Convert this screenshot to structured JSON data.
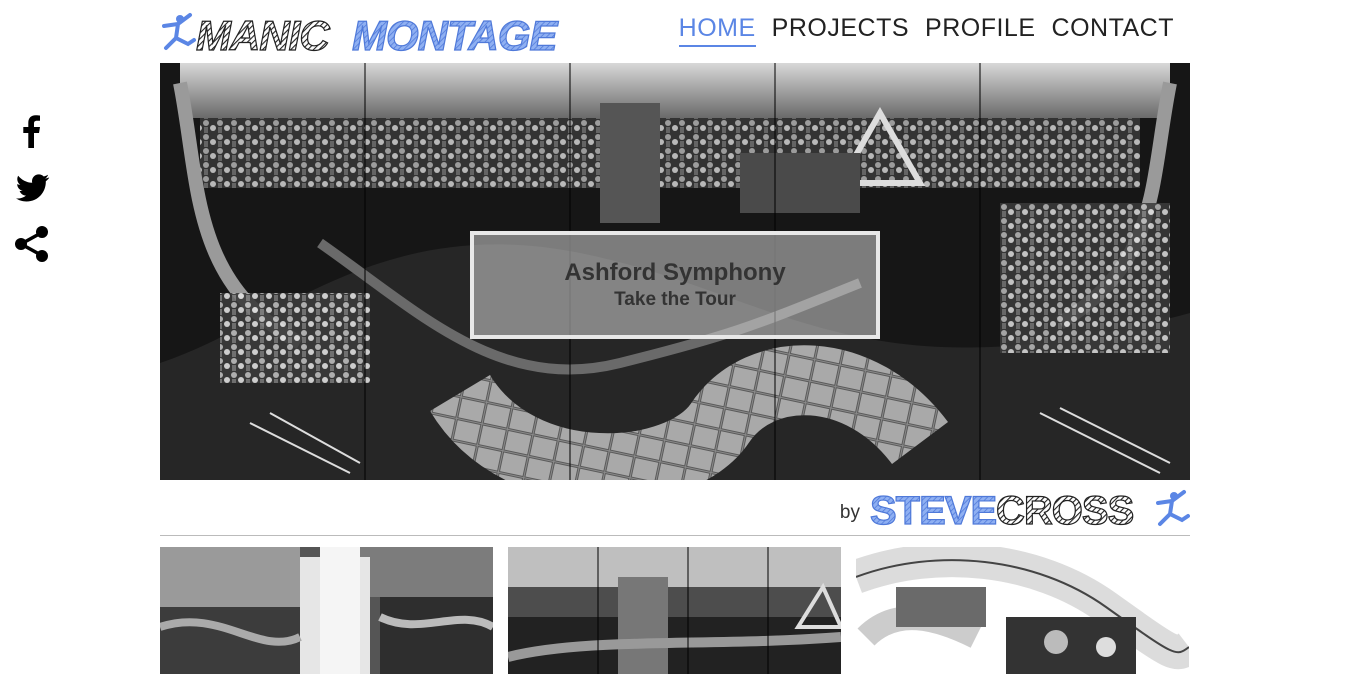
{
  "logo": {
    "part1": "MANIC",
    "part2": "MONTAGE",
    "icon": "dancer-figure-icon"
  },
  "nav": [
    {
      "label": "HOME",
      "active": true
    },
    {
      "label": "PROJECTS",
      "active": false
    },
    {
      "label": "PROFILE",
      "active": false
    },
    {
      "label": "CONTACT",
      "active": false
    }
  ],
  "social": [
    {
      "icon": "facebook-icon"
    },
    {
      "icon": "twitter-icon"
    },
    {
      "icon": "share-icon"
    }
  ],
  "hero": {
    "title": "Ashford Symphony",
    "subtitle": "Take the Tour"
  },
  "byline": {
    "by": "by",
    "name_part1": "STEVE",
    "name_part2": "CROSS"
  },
  "colors": {
    "accent": "#5b86e5",
    "text": "#222222"
  }
}
